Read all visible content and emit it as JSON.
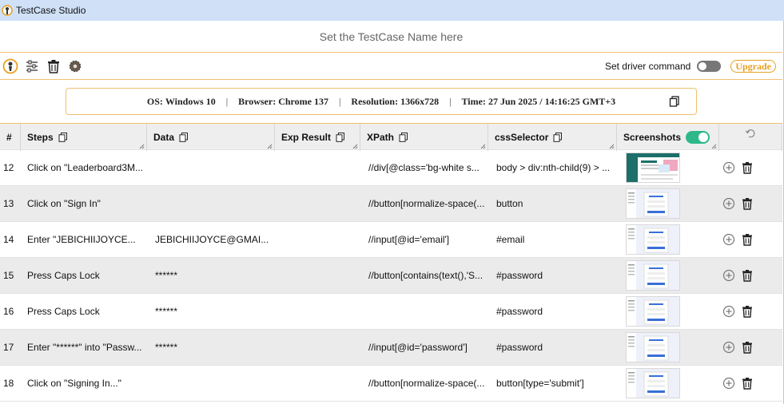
{
  "window": {
    "title": "TestCase Studio"
  },
  "testcase": {
    "name_placeholder": "Set the TestCase Name here"
  },
  "toolbar": {
    "driver_label": "Set driver command",
    "upgrade_label": "Upgrade",
    "icons": [
      "logo-icon",
      "sliders-icon",
      "trash-icon",
      "gear-icon"
    ]
  },
  "environment": {
    "os_label": "OS:",
    "os_value": "Windows 10",
    "browser_label": "Browser:",
    "browser_value": "Chrome 137",
    "resolution_label": "Resolution:",
    "resolution_value": "1366x728",
    "time_label": "Time:",
    "time_value": "27 Jun 2025 / 14:16:25 GMT+3",
    "separator": "|"
  },
  "table": {
    "headers": {
      "num": "#",
      "steps": "Steps",
      "data": "Data",
      "exp": "Exp Result",
      "xpath": "XPath",
      "css": "cssSelector",
      "shots": "Screenshots"
    },
    "screenshots_enabled": true,
    "rows": [
      {
        "num": "12",
        "step": "Click on \"Leaderboard3M...",
        "data": "",
        "exp": "",
        "xpath": "//div[@class='bg-white s...",
        "css": "body > div:nth-child(9) > ..."
      },
      {
        "num": "13",
        "step": "Click on \"Sign In\"",
        "data": "",
        "exp": "",
        "xpath": "//button[normalize-space(...",
        "css": "button"
      },
      {
        "num": "14",
        "step": "Enter \"JEBICHIIJOYCE...",
        "data": "JEBICHIIJOYCE@GMAI...",
        "exp": "",
        "xpath": "//input[@id='email']",
        "css": "#email"
      },
      {
        "num": "15",
        "step": "Press Caps Lock",
        "data": "******",
        "exp": "",
        "xpath": "//button[contains(text(),'S...",
        "css": "#password"
      },
      {
        "num": "16",
        "step": "Press Caps Lock",
        "data": "******",
        "exp": "",
        "xpath": "",
        "css": "#password"
      },
      {
        "num": "17",
        "step": "Enter \"******\" into \"Passw...",
        "data": "******",
        "exp": "",
        "xpath": "//input[@id='password']",
        "css": "#password"
      },
      {
        "num": "18",
        "step": "Click on \"Signing In...\"",
        "data": "",
        "exp": "",
        "xpath": "//button[normalize-space(...",
        "css": "button[type='submit']"
      }
    ]
  },
  "colors": {
    "accent": "#f0c070",
    "titlebar": "#cfe0f7",
    "toggle_on": "#2eb88a",
    "upgrade": "#e8a020"
  }
}
